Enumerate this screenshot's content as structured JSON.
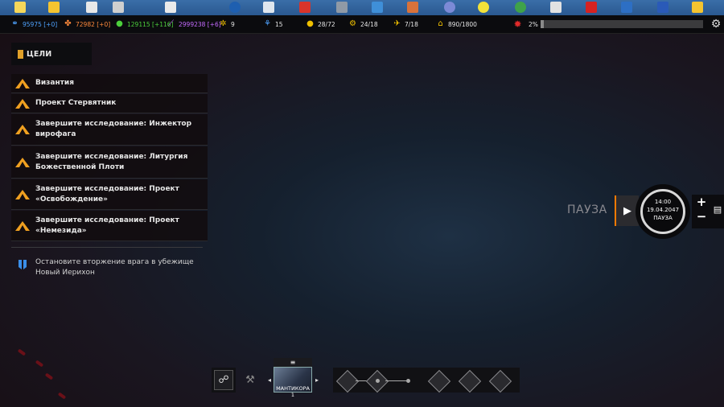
{
  "topbar": {
    "resources": [
      {
        "icon": "link-icon",
        "value": "95975 [+0]",
        "color": "#4fa3ff"
      },
      {
        "icon": "materials-icon",
        "value": "72982 [+0]",
        "color": "#ff8a3c"
      },
      {
        "icon": "food-icon",
        "value": "129115 [+116]",
        "color": "#4ccf3c"
      },
      {
        "icon": "elerium-icon",
        "value": "2999238 [+6]",
        "color": "#c56bff"
      }
    ],
    "counters": [
      {
        "icon": "research-icon",
        "value": "9"
      },
      {
        "icon": "scientist-icon",
        "value": "15"
      },
      {
        "icon": "personnel-icon",
        "value": "28/72"
      },
      {
        "icon": "vehicle-icon",
        "value": "24/18"
      },
      {
        "icon": "aircraft-icon",
        "value": "7/18"
      },
      {
        "icon": "living-space-icon",
        "value": "890/1800"
      }
    ],
    "threat": {
      "icon": "pandoravirus-icon",
      "value": "2%",
      "percent": 2
    }
  },
  "objectives": {
    "header": "ЦЕЛИ",
    "primary": [
      "Византия",
      "Проект Стервятник",
      "Завершите исследование: Инжектор вирофага",
      "Завершите исследование: Литургия Божественной Плоти",
      "Завершите исследование: Проект «Освобождение»",
      "Завершите исследование: Проект «Немезида»"
    ],
    "secondary": "Остановите вторжение врага в убежище Новый Иерихон"
  },
  "time": {
    "pause_label": "ПАУЗА",
    "clock": "14:00",
    "date": "19.04.2047",
    "state": "ПАУЗА",
    "plus": "+",
    "minus": "−"
  },
  "bottombar": {
    "ship_name": "МАНТИКОРА 1",
    "menu_glyph": "≡",
    "left_arrow": "◂",
    "right_arrow": "▸"
  },
  "colors": {
    "accent": "#ff7a00",
    "objective_icon": "#f0a020",
    "secondary_icon": "#3a8ee8"
  }
}
